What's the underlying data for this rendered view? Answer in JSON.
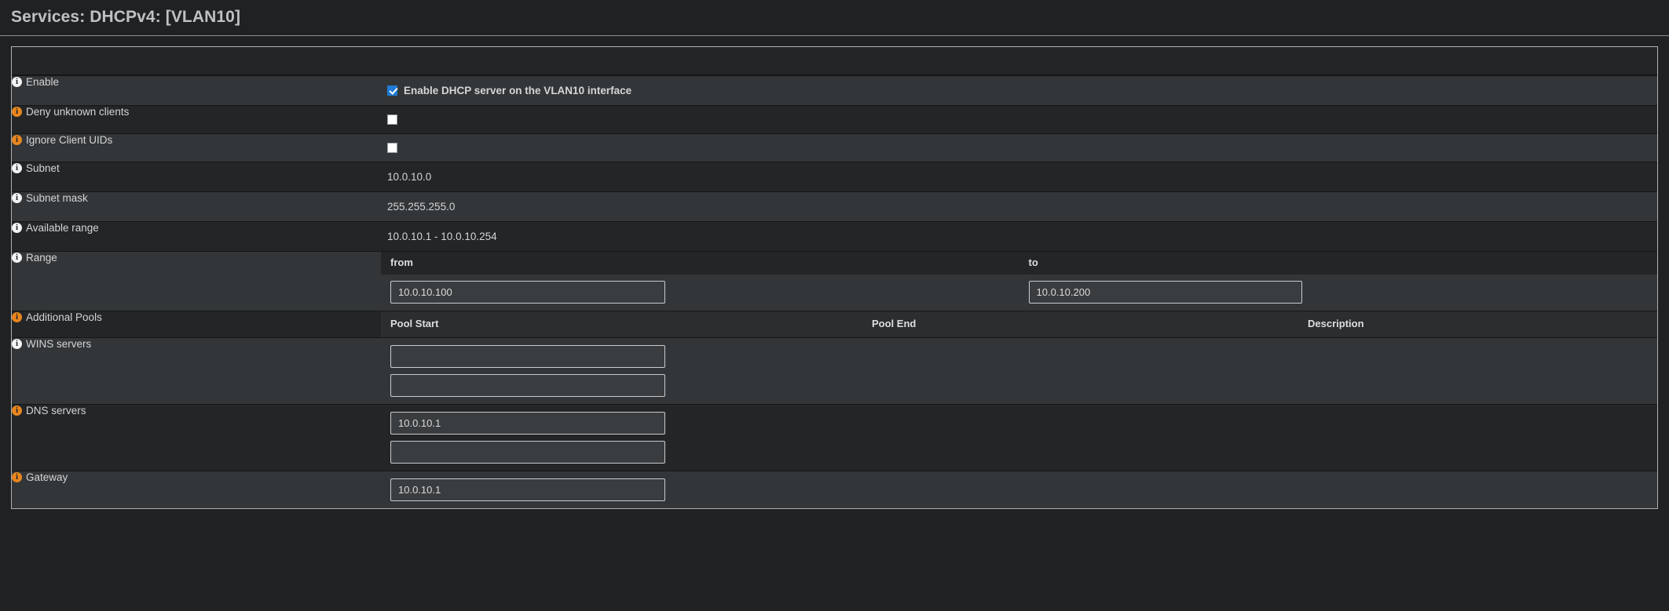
{
  "page": {
    "title": "Services: DHCPv4: [VLAN10]"
  },
  "form": {
    "rows": [
      {
        "label": "Enable",
        "icon": "info-icon-white",
        "type": "checkbox",
        "checked": true,
        "checkbox_label": "Enable DHCP server on the VLAN10 interface"
      },
      {
        "label": "Deny unknown clients",
        "icon": "info-icon-orange",
        "type": "checkbox",
        "checked": false,
        "checkbox_label": ""
      },
      {
        "label": "Ignore Client UIDs",
        "icon": "info-icon-orange",
        "type": "checkbox",
        "checked": false,
        "checkbox_label": ""
      },
      {
        "label": "Subnet",
        "icon": "info-icon-white",
        "type": "static",
        "value": "10.0.10.0"
      },
      {
        "label": "Subnet mask",
        "icon": "info-icon-white",
        "type": "static",
        "value": "255.255.255.0"
      },
      {
        "label": "Available range",
        "icon": "info-icon-white",
        "type": "static",
        "value": "10.0.10.1 - 10.0.10.254"
      }
    ]
  },
  "range": {
    "label": "Range",
    "icon": "info-icon-white",
    "from_label": "from",
    "to_label": "to",
    "from_value": "10.0.10.100",
    "to_value": "10.0.10.200"
  },
  "pools": {
    "label": "Additional Pools",
    "icon": "info-icon-orange",
    "columns": [
      "Pool Start",
      "Pool End",
      "Description"
    ]
  },
  "wins": {
    "label": "WINS servers",
    "icon": "info-icon-white",
    "values": [
      "",
      ""
    ]
  },
  "dns": {
    "label": "DNS servers",
    "icon": "info-icon-orange",
    "values": [
      "10.0.10.1",
      ""
    ]
  },
  "gateway": {
    "label": "Gateway",
    "icon": "info-icon-orange",
    "values": [
      "10.0.10.1"
    ]
  },
  "colors": {
    "accent_orange": "#e8861e",
    "checkbox_blue": "#1f7bd6",
    "row_light": "#333638",
    "row_dark": "#232527",
    "page_bg": "#1f2123",
    "text": "#d3d5d7"
  }
}
